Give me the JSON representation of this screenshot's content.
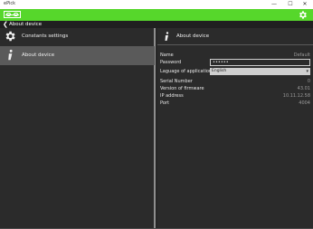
{
  "window": {
    "title": "ePick",
    "controls": {
      "minimize": "—",
      "maximize": "☐",
      "close": "✕"
    }
  },
  "appbar": {
    "logo_icon": "device-logo-icon",
    "settings_icon": "gear-icon"
  },
  "navbar": {
    "back_icon": "back-arrow-icon",
    "title": "About device"
  },
  "sidebar": {
    "items": [
      {
        "label": "Constants settings",
        "icon": "gear-icon",
        "active": false
      },
      {
        "label": "About device",
        "icon": "info-icon",
        "active": true
      }
    ]
  },
  "main": {
    "header": {
      "label": "About device",
      "icon": "info-icon"
    },
    "fields": {
      "name_label": "Name",
      "name_value": "Default",
      "password_label": "Password",
      "password_value": "••••••",
      "language_label": "Laguage of application",
      "language_value": "English",
      "serial_label": "Serial Number",
      "serial_value": "0",
      "firmware_label": "Version of firmware",
      "firmware_value": "43.01",
      "ip_label": "IP address",
      "ip_value": "10.11.12.58",
      "port_label": "Port",
      "port_value": "4004"
    }
  },
  "colors": {
    "accent": "#56d72b",
    "panel": "#2b2b2b",
    "active_item": "#5a5a5a"
  }
}
